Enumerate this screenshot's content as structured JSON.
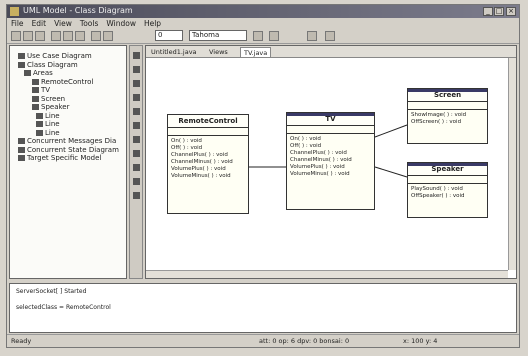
{
  "window": {
    "title": "UML Model - Class Diagram",
    "buttons": {
      "minimize": "_",
      "maximize": "□",
      "close": "×"
    }
  },
  "menu": [
    "File",
    "Edit",
    "View",
    "Tools",
    "Window",
    "Help"
  ],
  "toolbar": {
    "zoom_value": "0",
    "font_value": "Tahoma"
  },
  "tree": {
    "items": [
      {
        "label": "Use Case Diagram",
        "icon": "diagram-icon"
      },
      {
        "label": "Class Diagram",
        "icon": "diagram-icon"
      },
      {
        "label": "Areas",
        "icon": "folder-icon"
      },
      {
        "label": "RemoteControl",
        "icon": "class-icon"
      },
      {
        "label": "TV",
        "icon": "class-icon"
      },
      {
        "label": "Screen",
        "icon": "class-icon"
      },
      {
        "label": "Speaker",
        "icon": "class-icon"
      },
      {
        "label": "Line",
        "icon": "line-icon"
      },
      {
        "label": "Line",
        "icon": "line-icon"
      },
      {
        "label": "Line",
        "icon": "line-icon"
      },
      {
        "label": "Concurrent Messages Dia",
        "icon": "diagram-icon"
      },
      {
        "label": "Concurrent State Diagram",
        "icon": "diagram-icon"
      },
      {
        "label": "Target Specific Model",
        "icon": "diagram-icon"
      }
    ]
  },
  "tabs": [
    {
      "label": "Untitled1.java"
    },
    {
      "label": "Views"
    },
    {
      "label": "TV.java"
    }
  ],
  "diagram": {
    "classes": [
      {
        "name": "RemoteControl",
        "ops": [
          "On( ) : void",
          "Off( ) : void",
          "ChannelPlus( ) : void",
          "ChannelMinus( ) : void",
          "VolumePlus( ) : void",
          "VolumeMinus( ) : void"
        ]
      },
      {
        "name": "TV",
        "ops": [
          "On( ) : void",
          "Off( ) : void",
          "ChannelPlus( ) : void",
          "ChannelMinus( ) : void",
          "VolumePlus( ) : void",
          "VolumeMinus( ) : void"
        ]
      },
      {
        "name": "Screen",
        "ops": [
          "ShowImage( ) : void",
          "OffScreen( ) : void"
        ]
      },
      {
        "name": "Speaker",
        "ops": [
          "PlaySound( ) : void",
          "OffSpeaker( ) : void"
        ]
      }
    ],
    "accent": "#3a3a66"
  },
  "console": {
    "lines": [
      "ServerSocket[ ] Started",
      "",
      "selectedClass = RemoteControl"
    ]
  },
  "status": {
    "left": "Ready",
    "middle": "att: 0  op: 6  dpv: 0  bonsai: 0",
    "right": "x: 100  y: 4"
  }
}
